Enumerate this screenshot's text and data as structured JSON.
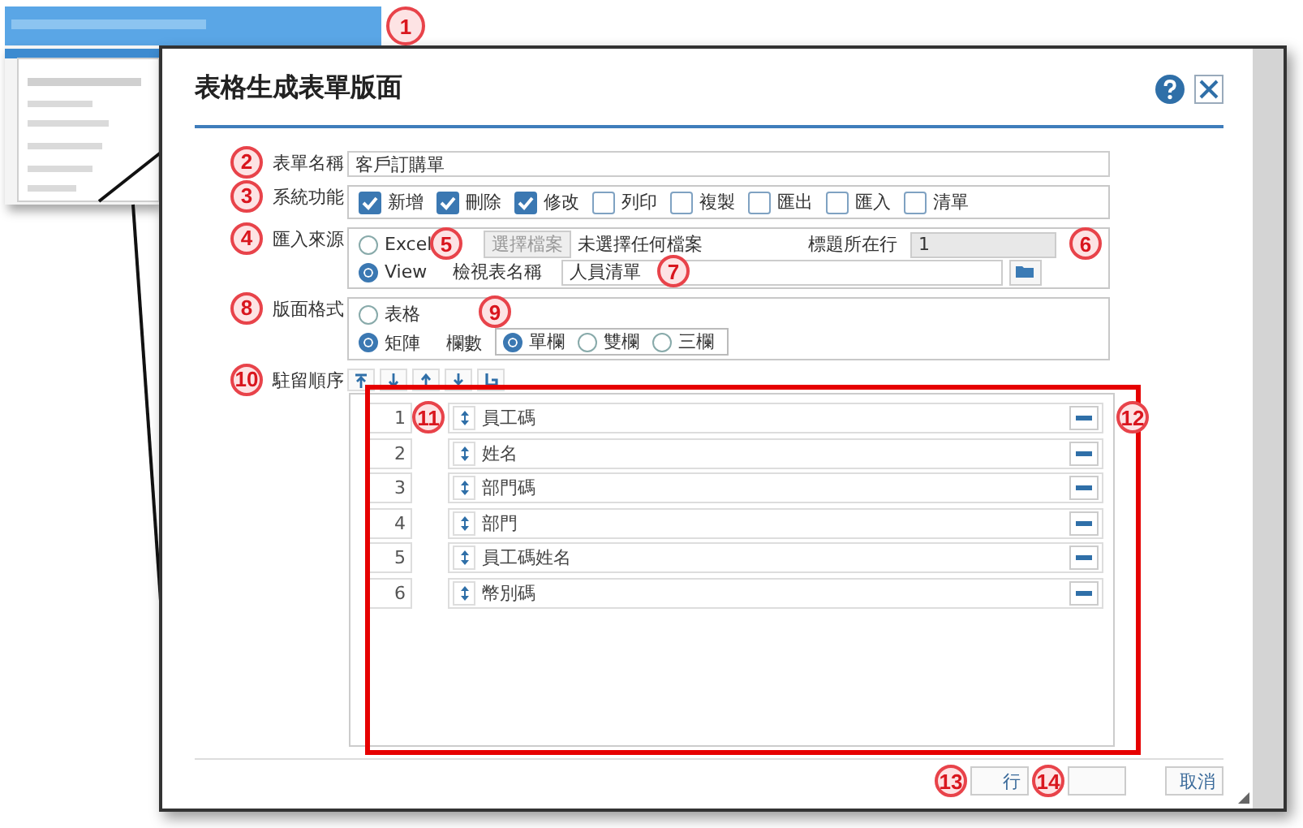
{
  "thumbnail": {
    "callout": "1"
  },
  "dialog": {
    "title": "表格生成表單版面"
  },
  "form_name": {
    "label": "表單名稱",
    "value": "客戶訂購單",
    "callout": "2"
  },
  "functions": {
    "label": "系統功能",
    "callout": "3",
    "options": [
      {
        "label": "新增",
        "checked": true
      },
      {
        "label": "刪除",
        "checked": true
      },
      {
        "label": "修改",
        "checked": true
      },
      {
        "label": "列印",
        "checked": false
      },
      {
        "label": "複製",
        "checked": false
      },
      {
        "label": "匯出",
        "checked": false
      },
      {
        "label": "匯入",
        "checked": false
      },
      {
        "label": "清單",
        "checked": false
      }
    ]
  },
  "import_source": {
    "label": "匯入來源",
    "callout": "4",
    "options": [
      {
        "label": "Excel",
        "selected": false
      },
      {
        "label": "View",
        "selected": true
      }
    ],
    "file_button": {
      "label": "選擇檔案",
      "disabled": true,
      "callout": "5"
    },
    "file_status": "未選擇任何檔案",
    "header_row": {
      "label": "標題所在行",
      "value": "1",
      "callout": "6"
    },
    "view_name": {
      "label": "檢視表名稱",
      "value": "人員清單",
      "callout": "7"
    }
  },
  "layout": {
    "label": "版面格式",
    "callout": "8",
    "options": [
      {
        "label": "表格",
        "selected": false
      },
      {
        "label": "矩陣",
        "selected": true
      }
    ],
    "columns": {
      "label": "欄數",
      "callout": "9",
      "options": [
        {
          "label": "單欄",
          "selected": true
        },
        {
          "label": "雙欄",
          "selected": false
        },
        {
          "label": "三欄",
          "selected": false
        }
      ]
    }
  },
  "order": {
    "label": "駐留順序",
    "callout": "10",
    "handle_callout": "11",
    "remove_callout": "12",
    "rows": [
      {
        "index": "1",
        "name": "員工碼"
      },
      {
        "index": "2",
        "name": "姓名"
      },
      {
        "index": "3",
        "name": "部門碼"
      },
      {
        "index": "4",
        "name": "部門"
      },
      {
        "index": "5",
        "name": "員工碼姓名"
      },
      {
        "index": "6",
        "name": "幣別碼"
      }
    ]
  },
  "footer": {
    "buttons": [
      {
        "label": "行",
        "callout": "13"
      },
      {
        "callout": "14"
      },
      {
        "label": "取消"
      }
    ]
  }
}
